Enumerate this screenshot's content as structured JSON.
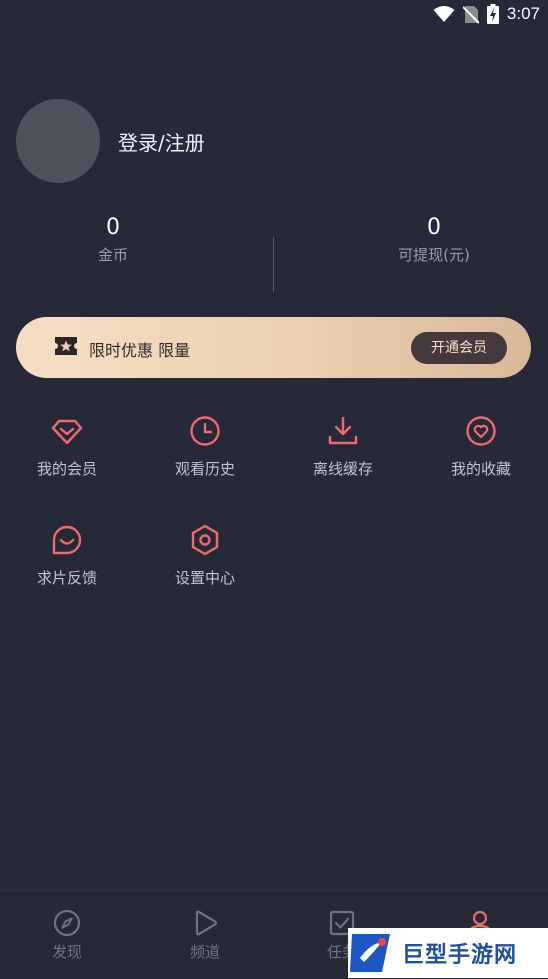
{
  "status_bar": {
    "time": "3:07",
    "icons": [
      "wifi-icon",
      "no-sim-icon",
      "battery-charging-icon"
    ]
  },
  "profile": {
    "login_label": "登录/注册"
  },
  "stats": {
    "coins": {
      "value": "0",
      "label": "金币"
    },
    "withdrawable": {
      "value": "0",
      "label": "可提现(元)"
    }
  },
  "promo_banner": {
    "text": "限时优惠 限量",
    "button_label": "开通会员",
    "icon": "ticket-star-icon"
  },
  "menu": [
    {
      "label": "我的会员",
      "icon": "diamond-icon"
    },
    {
      "label": "观看历史",
      "icon": "clock-icon"
    },
    {
      "label": "离线缓存",
      "icon": "download-icon"
    },
    {
      "label": "我的收藏",
      "icon": "heart-icon"
    },
    {
      "label": "求片反馈",
      "icon": "feedback-bubble-icon"
    },
    {
      "label": "设置中心",
      "icon": "settings-hexagon-icon"
    }
  ],
  "tab_bar": [
    {
      "label": "发现",
      "icon": "compass-icon"
    },
    {
      "label": "频道",
      "icon": "play-icon"
    },
    {
      "label": "任务",
      "icon": "task-check-icon"
    },
    {
      "label": "",
      "icon": "user-icon"
    }
  ],
  "watermark": {
    "text": "巨型手游网"
  },
  "colors": {
    "background": "#262a38",
    "accent": "#f06a6a",
    "banner_gold": "#ecd0b1"
  }
}
